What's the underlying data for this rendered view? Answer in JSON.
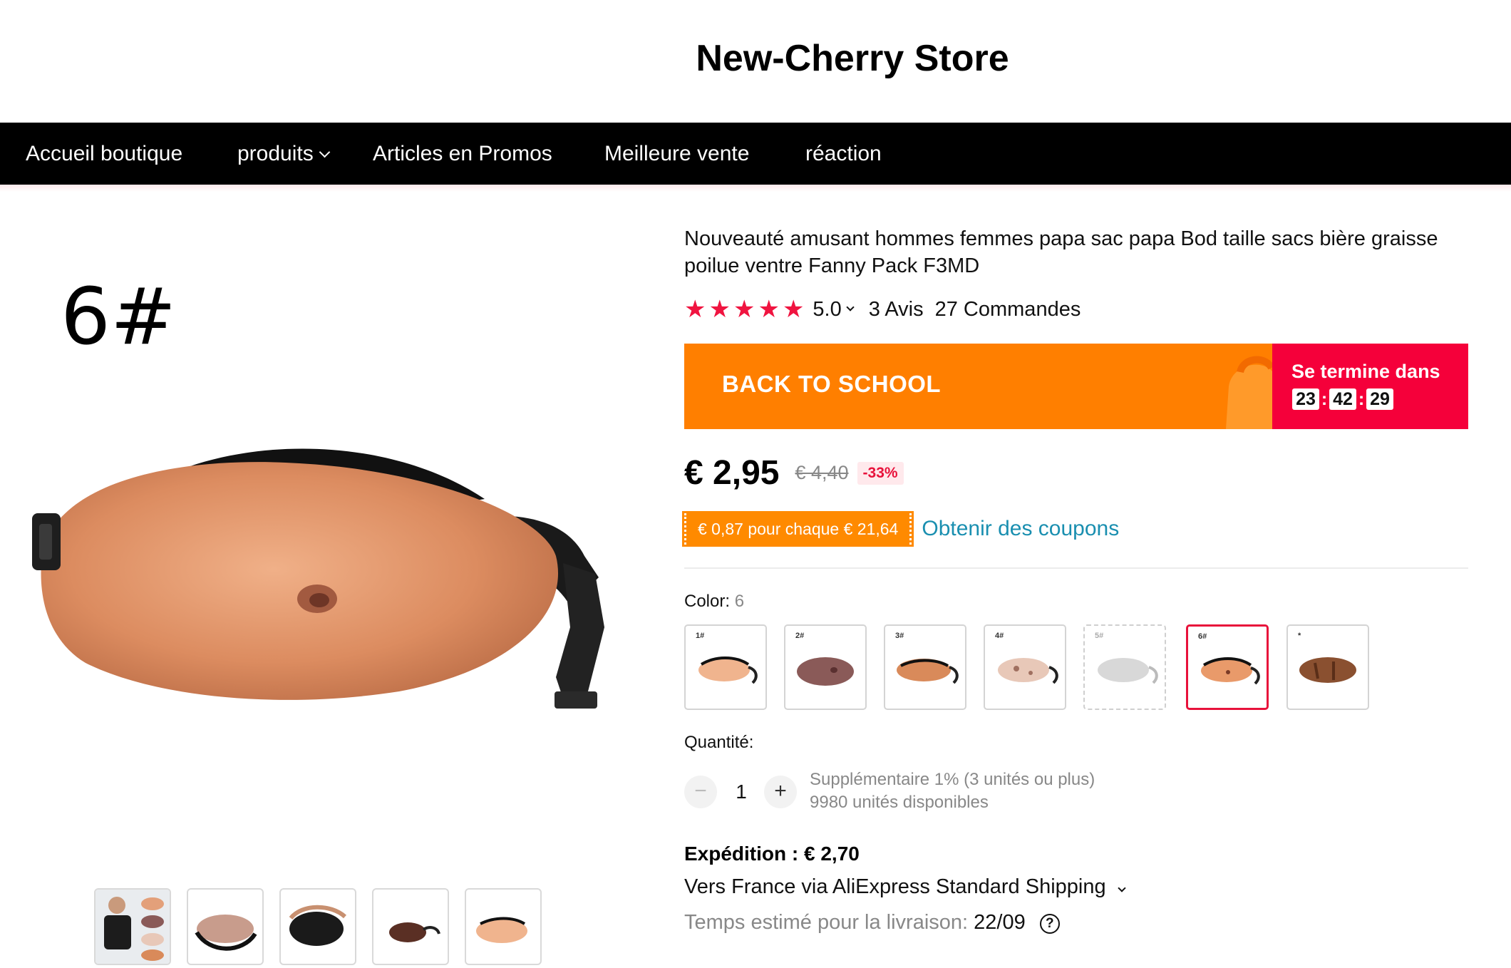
{
  "store": {
    "name": "New-Cherry Store"
  },
  "nav": {
    "items": [
      {
        "label": "Accueil boutique"
      },
      {
        "label": "produits",
        "dropdown": true
      },
      {
        "label": "Articles en Promos"
      },
      {
        "label": "Meilleure vente"
      },
      {
        "label": "réaction"
      }
    ]
  },
  "gallery": {
    "main_label": "6#",
    "thumbnails": [
      "model-collage",
      "pack-open-top",
      "pack-black-back",
      "pack-dark-small",
      "pack-1"
    ]
  },
  "product": {
    "title": "Nouveauté amusant hommes femmes papa sac papa Bod taille sacs bière graisse poilue ventre Fanny Pack F3MD",
    "rating": "5.0",
    "stars": 5,
    "reviews": "3 Avis",
    "orders": "27 Commandes"
  },
  "promo": {
    "title": "BACK TO SCHOOL",
    "ends_label": "Se termine dans",
    "hours": "23",
    "minutes": "42",
    "seconds": "29",
    "bg_color": "#ff7f00",
    "timer_color": "#f5003a"
  },
  "price": {
    "current": "€ 2,95",
    "original": "€ 4,40",
    "discount": "-33%"
  },
  "coupon": {
    "badge": "€ 0,87 pour chaque € 21,64",
    "link": "Obtenir des coupons"
  },
  "color": {
    "label": "Color:",
    "selected": "6",
    "options": [
      {
        "tag": "1#",
        "tone": "#f0b48e",
        "state": "normal"
      },
      {
        "tag": "2#",
        "tone": "#8a5a58",
        "state": "normal"
      },
      {
        "tag": "3#",
        "tone": "#d98a5a",
        "state": "normal"
      },
      {
        "tag": "4#",
        "tone": "#e8c8b8",
        "state": "normal"
      },
      {
        "tag": "5#",
        "tone": "#d8d8d8",
        "state": "unavailable"
      },
      {
        "tag": "6#",
        "tone": "#e99a6a",
        "state": "selected"
      },
      {
        "tag": "*",
        "tone": "#8a5030",
        "state": "normal"
      }
    ]
  },
  "quantity": {
    "label": "Quantité:",
    "minus": "−",
    "value": "1",
    "plus": "+",
    "extra": "Supplémentaire 1% (3 unités ou plus)",
    "available": "9980 unités disponibles"
  },
  "shipping": {
    "title": "Expédition : € 2,70",
    "route": "Vers France via AliExpress Standard Shipping",
    "eta_label": "Temps estimé pour la livraison:",
    "eta_date": "22/09",
    "help": "?"
  }
}
